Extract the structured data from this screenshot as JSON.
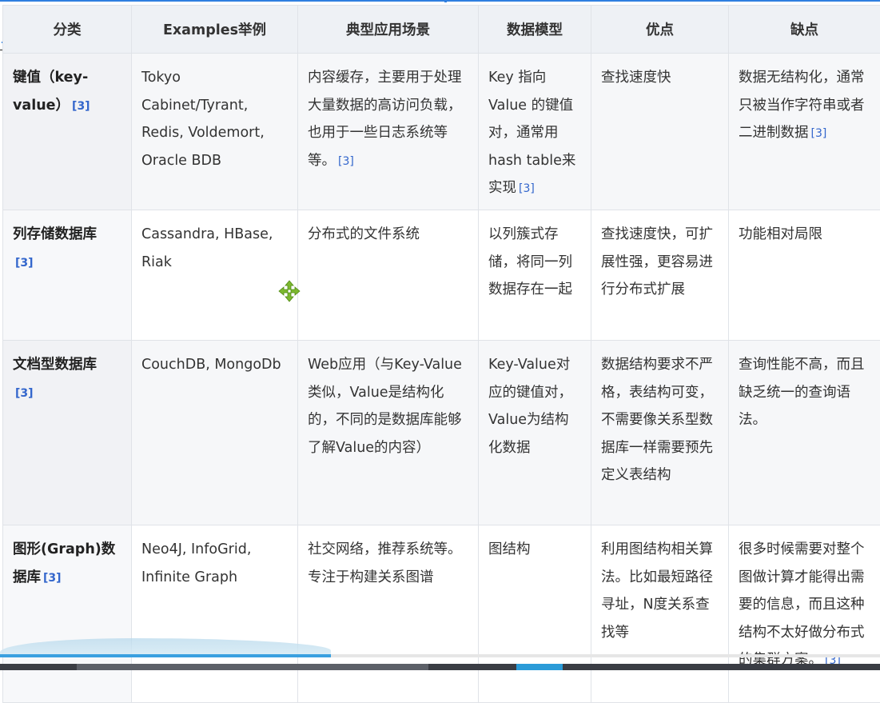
{
  "table": {
    "headers": [
      "分类",
      "Examples举例",
      "典型应用场景",
      "数据模型",
      "优点",
      "缺点"
    ],
    "rows": [
      {
        "category": "键值（key-value）",
        "category_ref": "[3]",
        "examples": "Tokyo Cabinet/Tyrant, Redis, Voldemort, Oracle BDB",
        "scenario": "内容缓存，主要用于处理大量数据的高访问负载，也用于一些日志系统等等。",
        "scenario_ref": "[3]",
        "model": "Key 指向 Value 的键值对，通常用hash table来实现",
        "model_ref": "[3]",
        "pros": "查找速度快",
        "cons": "数据无结构化，通常只被当作字符串或者二进制数据",
        "cons_ref": "[3]"
      },
      {
        "category": "列存储数据库",
        "category_ref": "[3]",
        "examples": "Cassandra, HBase, Riak",
        "scenario": "分布式的文件系统",
        "model": "以列簇式存储，将同一列数据存在一起",
        "pros": "查找速度快，可扩展性强，更容易进行分布式扩展",
        "cons": "功能相对局限"
      },
      {
        "category": "文档型数据库",
        "category_ref": "[3]",
        "examples": "CouchDB, MongoDb",
        "scenario": "Web应用（与Key-Value类似，Value是结构化的，不同的是数据库能够了解Value的内容）",
        "model": "Key-Value对应的键值对，Value为结构化数据",
        "pros": "数据结构要求不严格，表结构可变，不需要像关系型数据库一样需要预先定义表结构",
        "cons": "查询性能不高，而且缺乏统一的查询语法。"
      },
      {
        "category": "图形(Graph)数据库",
        "category_ref": "[3]",
        "examples": "Neo4J, InfoGrid, Infinite Graph",
        "scenario": "社交网络，推荐系统等。专注于构建关系图谱",
        "model": "图结构",
        "pros": "利用图结构相关算法。比如最短路径寻址，N度关系查找等",
        "cons": "很多时候需要对整个图做计算才能得出需要的信息，而且这种结构不太好做分布式的集群方案。",
        "cons_ref": "[3]"
      }
    ]
  },
  "colors": {
    "header_bg": "#eef1f5",
    "border": "#e0e3e8",
    "ref_link": "#3366cc",
    "scroll_thumb": "#3aa0e0",
    "move_icon": "#7cb82f"
  },
  "icons": {
    "move_cursor": "move-arrows-icon"
  }
}
